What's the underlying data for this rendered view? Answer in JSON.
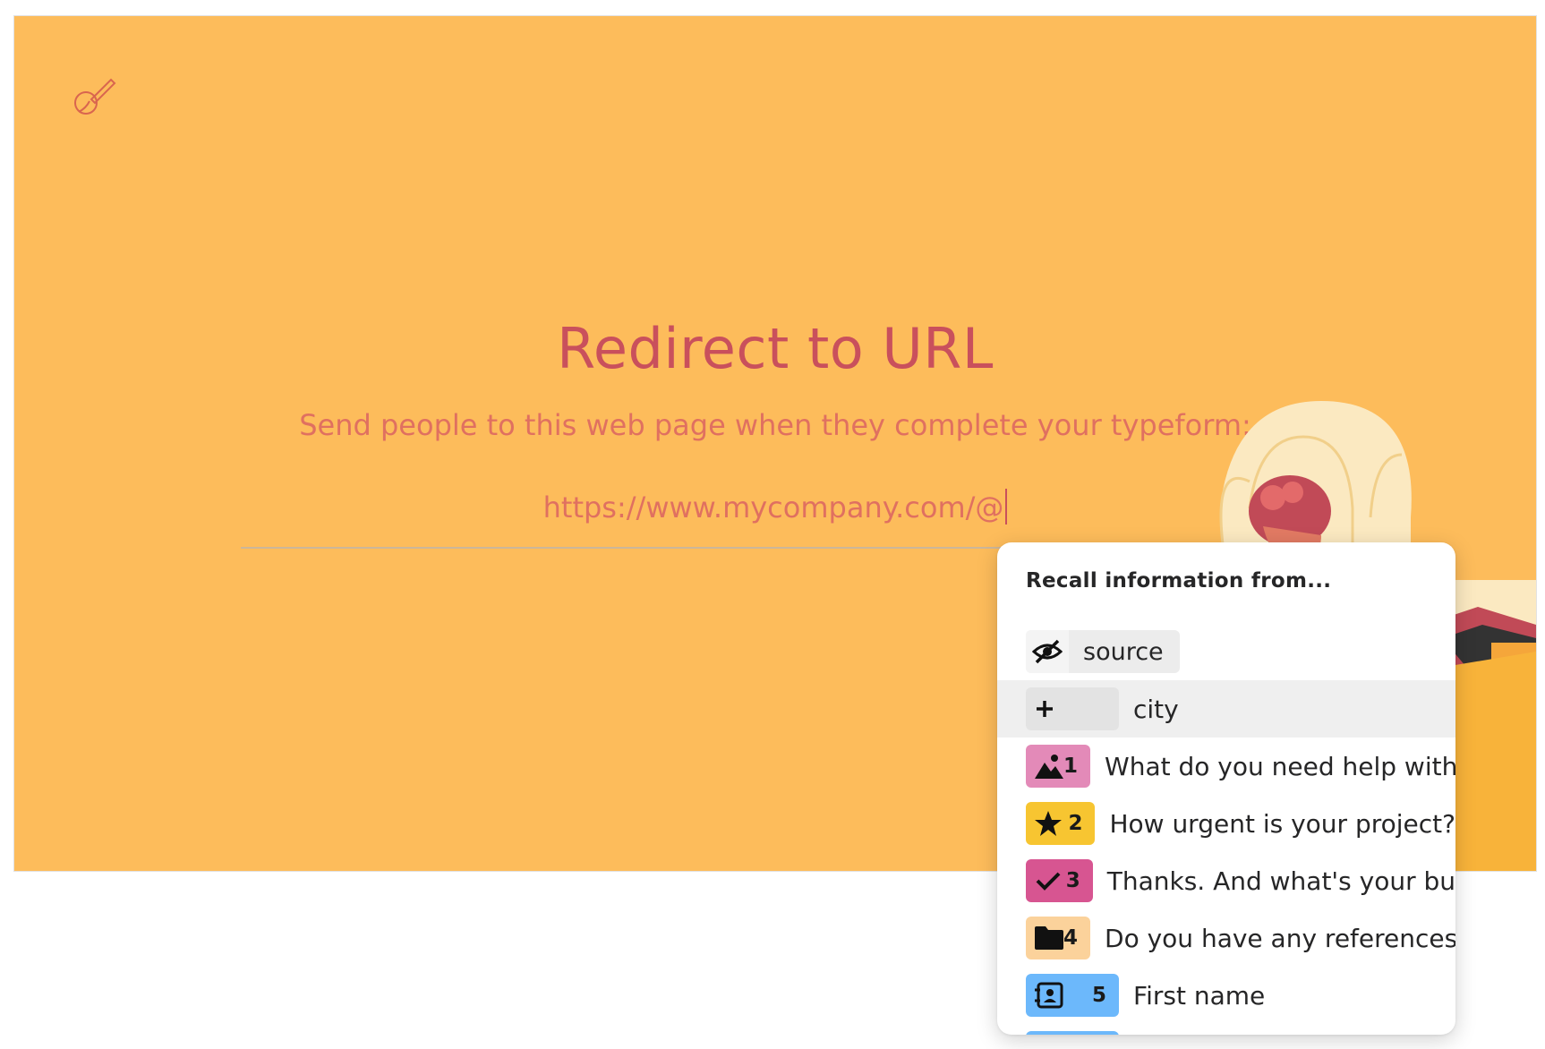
{
  "page": {
    "title": "Redirect to URL",
    "subtitle": "Send people to this web page when they complete your typeform:",
    "url_value": "https://www.mycompany.com/@"
  },
  "colors": {
    "background": "#fdbc5b",
    "title": "#c9505c",
    "subtitle": "#e07060"
  },
  "dropdown": {
    "header": "Recall information from...",
    "items": [
      {
        "icon": "eye-slash-icon",
        "number": "",
        "label": "source",
        "color": "#ececec"
      },
      {
        "icon": "plus-icon",
        "number": "",
        "label": "city",
        "color": "#e3e3e3"
      },
      {
        "icon": "image-icon",
        "number": "1",
        "label": "What do you need help with",
        "color": "#e38ab8"
      },
      {
        "icon": "star-icon",
        "number": "2",
        "label": "How urgent is your project?",
        "color": "#f7c531"
      },
      {
        "icon": "check-icon",
        "number": "3",
        "label": "Thanks. And what's your bu",
        "color": "#d75591"
      },
      {
        "icon": "folder-icon",
        "number": "4",
        "label": "Do you have any references",
        "color": "#fbd29b"
      },
      {
        "icon": "contact-card-icon",
        "number": "5",
        "label": "First name",
        "color": "#6cb8fb"
      },
      {
        "icon": "",
        "number": "",
        "label": "",
        "color": "#6cb8fb"
      }
    ]
  }
}
